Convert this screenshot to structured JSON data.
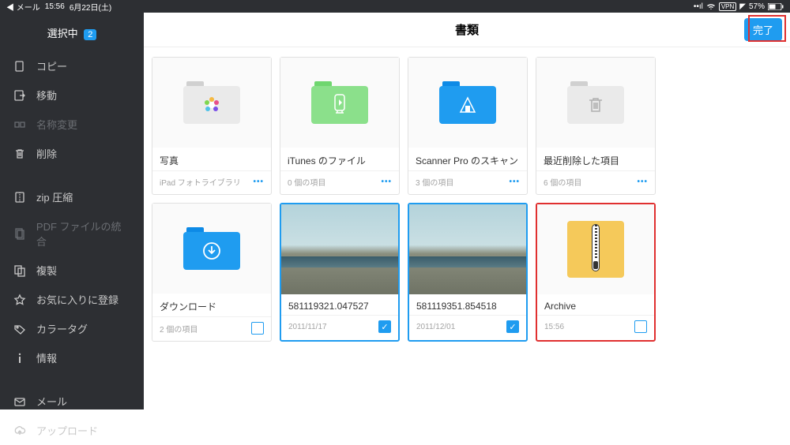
{
  "status": {
    "back_app": "◀ メール",
    "time": "15:56",
    "date": "6月22日(土)",
    "vpn": "VPN",
    "battery": "57%"
  },
  "sidebar": {
    "title": "選択中",
    "count": "2",
    "items": [
      {
        "label": "コピー",
        "icon": "copy"
      },
      {
        "label": "移動",
        "icon": "move"
      },
      {
        "label": "名称変更",
        "icon": "rename",
        "disabled": true
      },
      {
        "label": "削除",
        "icon": "trash"
      },
      {
        "label": "zip 圧縮",
        "icon": "zip"
      },
      {
        "label": "PDF ファイルの統合",
        "icon": "pdf",
        "disabled": true
      },
      {
        "label": "複製",
        "icon": "duplicate"
      },
      {
        "label": "お気に入りに登録",
        "icon": "star"
      },
      {
        "label": "カラータグ",
        "icon": "tag"
      },
      {
        "label": "情報",
        "icon": "info"
      },
      {
        "label": "メール",
        "icon": "mail"
      },
      {
        "label": "アップロード",
        "icon": "upload"
      }
    ]
  },
  "main": {
    "title": "書類",
    "done": "完了"
  },
  "items": [
    {
      "name": "写真",
      "meta": "iPad フォトライブラリ",
      "type": "folder",
      "color": "gray",
      "glyph": "photos",
      "action": "more"
    },
    {
      "name": "iTunes のファイル",
      "meta": "0 個の項目",
      "type": "folder",
      "color": "green",
      "glyph": "itunes",
      "action": "more"
    },
    {
      "name": "Scanner Pro のスキャン",
      "meta": "3 個の項目",
      "type": "folder",
      "color": "blue",
      "glyph": "scanner",
      "action": "more"
    },
    {
      "name": "最近削除した項目",
      "meta": "6 個の項目",
      "type": "folder",
      "color": "gray",
      "glyph": "trash",
      "action": "more"
    },
    {
      "name": "ダウンロード",
      "meta": "2 個の項目",
      "type": "folder",
      "color": "blue",
      "glyph": "download",
      "action": "checkbox",
      "checked": false
    },
    {
      "name": "581119321.047527",
      "meta": "2011/11/17",
      "type": "pano",
      "selected": true,
      "action": "checkbox",
      "checked": true
    },
    {
      "name": "581119351.854518",
      "meta": "2011/12/01",
      "type": "pano",
      "selected": true,
      "action": "checkbox",
      "checked": true
    },
    {
      "name": "Archive",
      "meta": "15:56",
      "type": "zip",
      "highlight": true,
      "action": "checkbox",
      "checked": false
    }
  ]
}
